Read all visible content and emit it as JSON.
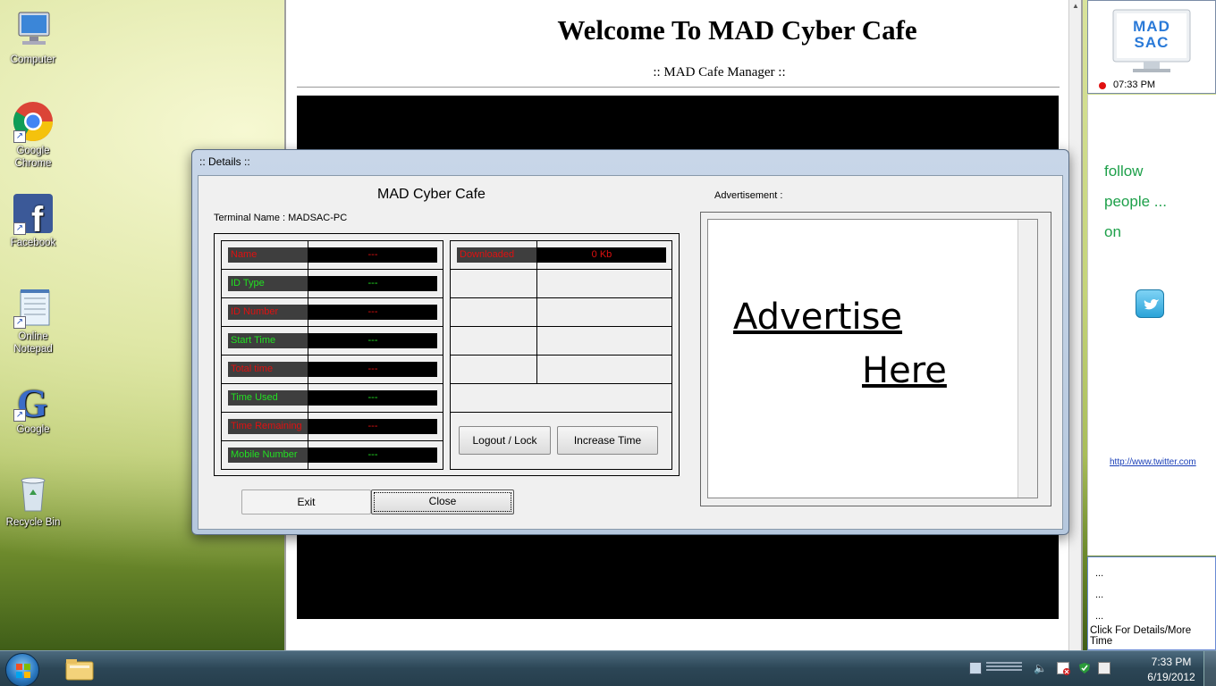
{
  "desktop": {
    "icons": [
      {
        "label": "Computer",
        "icon": "computer-icon"
      },
      {
        "label": "Google Chrome",
        "icon": "chrome-icon"
      },
      {
        "label": "Facebook",
        "icon": "facebook-icon"
      },
      {
        "label": "Online Notepad",
        "icon": "notepad-icon"
      },
      {
        "label": "Google",
        "icon": "google-icon"
      },
      {
        "label": "Recycle Bin",
        "icon": "recycle-bin-icon"
      }
    ]
  },
  "main": {
    "title": "Welcome To MAD Cyber Cafe",
    "subtitle": ":: MAD Cafe Manager ::"
  },
  "side": {
    "logo_text": "MAD SAC",
    "status_time": "07:33 PM",
    "follow_lines": [
      "follow",
      "people ...",
      "on"
    ],
    "twitter_link": "http://www.twitter.com",
    "bottom_lines": [
      "...",
      "...",
      "..."
    ],
    "details_link": "Click For Details/More Time"
  },
  "dialog": {
    "title": "::  Details  ::",
    "cafe_name": "MAD Cyber Cafe",
    "terminal_label": "Terminal Name : MADSAC-PC",
    "ad_label": "Advertisement :",
    "info_rows": [
      {
        "label": "Name",
        "value": "---",
        "color": "red"
      },
      {
        "label": "ID Type",
        "value": "---",
        "color": "green"
      },
      {
        "label": "ID Number",
        "value": "---",
        "color": "red"
      },
      {
        "label": "Start Time",
        "value": "---",
        "color": "green"
      },
      {
        "label": "Total time",
        "value": "---",
        "color": "red"
      },
      {
        "label": "Time Used",
        "value": "---",
        "color": "green"
      },
      {
        "label": "Time Remaining",
        "value": "---",
        "color": "red"
      },
      {
        "label": "Mobile Number",
        "value": "---",
        "color": "green"
      }
    ],
    "stats": {
      "downloaded_label": "Downloaded",
      "downloaded_value": "0 Kb"
    },
    "logout_button": "Logout / Lock",
    "increase_button": "Increase Time",
    "exit_button": "Exit",
    "close_button": "Close",
    "ad_line1": "Advertise",
    "ad_line2": "Here"
  },
  "taskbar": {
    "time": "7:33 PM",
    "date": "6/19/2012"
  },
  "colors": {
    "red_text": "#e01010",
    "green_text": "#22e022",
    "follow_green": "#1ea04a"
  }
}
